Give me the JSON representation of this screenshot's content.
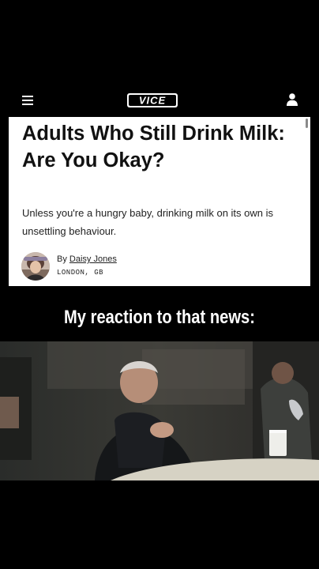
{
  "navbar": {
    "logo_text": "VICE",
    "menu_icon": "hamburger-menu-icon",
    "user_icon": "user-profile-icon"
  },
  "article": {
    "headline": "Adults Who Still Drink Milk: Are You Okay?",
    "dek": "Unless you're a hungry baby, drinking milk on its own is unsettling behaviour.",
    "byline_prefix": "By",
    "author": "Daisy Jones",
    "location": "LONDON, GB"
  },
  "caption": "My reaction to that news:",
  "scene": {
    "description_icon": "movie-still-image"
  },
  "colors": {
    "background": "#000000",
    "card": "#ffffff",
    "text": "#111111"
  }
}
